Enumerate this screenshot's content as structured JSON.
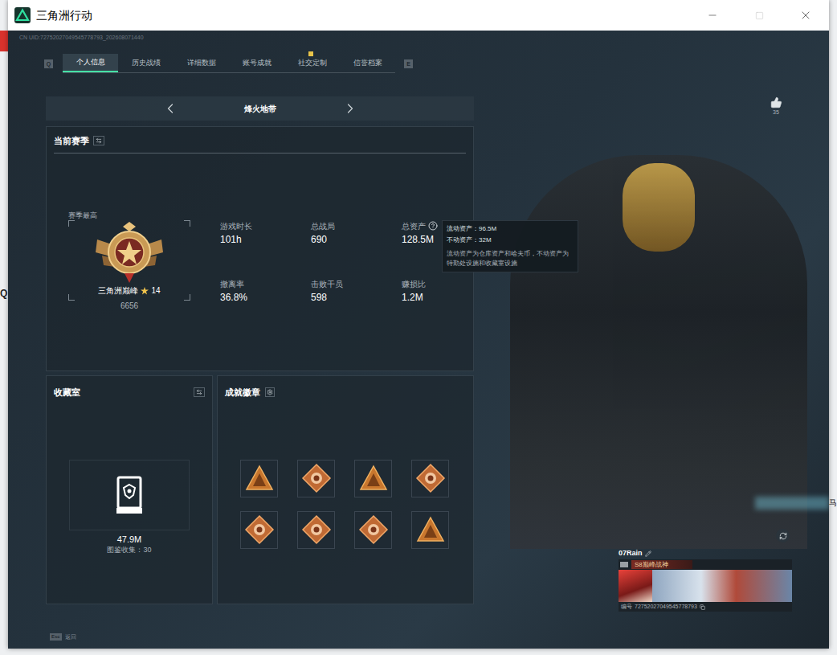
{
  "window": {
    "title": "三角洲行动"
  },
  "background_fragments": {
    "left": "Q",
    "right": "马"
  },
  "uid": "CN UID:72752027049545778793_202608071440",
  "tab_keys": {
    "prev": "Q",
    "next": "E"
  },
  "tabs": [
    {
      "label": "个人信息",
      "selected": true,
      "marked": false
    },
    {
      "label": "历史战绩",
      "selected": false,
      "marked": false
    },
    {
      "label": "详细数据",
      "selected": false,
      "marked": false
    },
    {
      "label": "账号成就",
      "selected": false,
      "marked": false
    },
    {
      "label": "社交定制",
      "selected": false,
      "marked": true
    },
    {
      "label": "信誉档案",
      "selected": false,
      "marked": false
    }
  ],
  "mode": {
    "label": "烽火地带"
  },
  "season": {
    "title": "当前赛季",
    "rank_label": "赛季最高",
    "rank_name": "三角洲巅峰",
    "stars": "14",
    "score": "6656",
    "stats": [
      {
        "label": "游戏时长",
        "value": "101h",
        "help": false
      },
      {
        "label": "总战局",
        "value": "690",
        "help": false
      },
      {
        "label": "总资产",
        "value": "128.5M",
        "help": true
      },
      {
        "label": "撤离率",
        "value": "36.8%",
        "help": false
      },
      {
        "label": "击败干员",
        "value": "598",
        "help": false
      },
      {
        "label": "赚损比",
        "value": "1.2M",
        "help": false
      }
    ]
  },
  "tooltip": {
    "lines": [
      "流动资产：96.5M",
      "不动资产：32M"
    ],
    "note": "流动资产为仓库资产和哈夫币，不动资产为特勤处设施和收藏室设施"
  },
  "collection": {
    "title": "收藏室",
    "value": "47.9M",
    "caption": "图鉴收集：30"
  },
  "achievements": {
    "title": "成就徽章",
    "badges": [
      {
        "kind": "triangle"
      },
      {
        "kind": "diamond"
      },
      {
        "kind": "triangle"
      },
      {
        "kind": "diamond"
      },
      {
        "kind": "diamond"
      },
      {
        "kind": "diamond"
      },
      {
        "kind": "diamond"
      },
      {
        "kind": "triangle"
      }
    ]
  },
  "likes": "35",
  "player": {
    "name": "07Rain",
    "title": "S8巅峰战神",
    "id_label": "编号",
    "id": "72752027049545778793"
  },
  "footer": {
    "key": "Esc",
    "label": "返回"
  }
}
